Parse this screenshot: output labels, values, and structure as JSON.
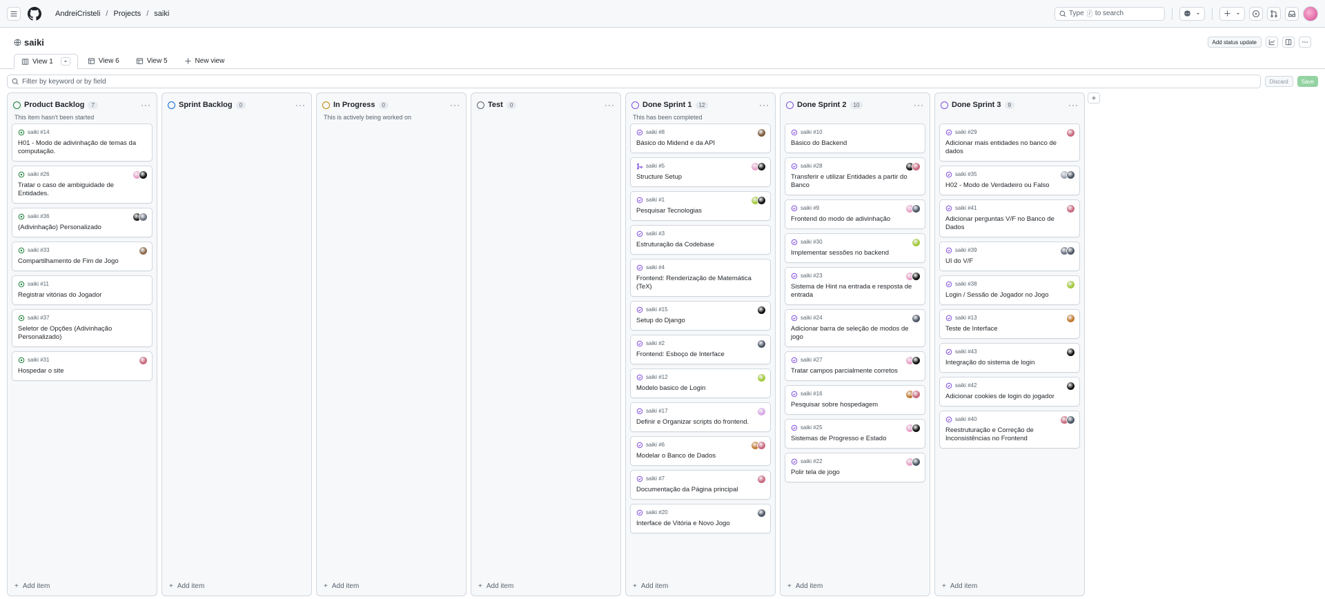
{
  "breadcrumb": {
    "user": "AndreiCristeli",
    "projects": "Projects",
    "project": "saiki"
  },
  "search": {
    "type": "Type",
    "slash": "/",
    "rest": "to search"
  },
  "project": {
    "title": "saiki",
    "status_update": "Add status update"
  },
  "tabs": [
    {
      "label": "View 1",
      "active": true
    },
    {
      "label": "View 6"
    },
    {
      "label": "View 5"
    },
    {
      "label": "New view"
    }
  ],
  "filter": {
    "placeholder": "Filter by keyword or by field",
    "discard": "Discard",
    "save": "Save"
  },
  "add_item_label": "Add item",
  "colors": {
    "green": "#1a7f37",
    "blue": "#0969da",
    "yellow": "#bf8700",
    "gray": "#59636e",
    "purple": "#8250df",
    "done": "#8250df"
  },
  "columns": [
    {
      "name": "Product Backlog",
      "count": "7",
      "status_color": "#1a7f37",
      "description": "This item hasn't been started",
      "cards": [
        {
          "ref": "saiki #14",
          "title": "H01 - Modo de adivinhação de temas da computação.",
          "state": "open",
          "avatars": []
        },
        {
          "ref": "saiki #26",
          "title": "Tratar o caso de ambiguidade de Entidades.",
          "state": "open",
          "avatars": [
            "#e8a1c8",
            "#111111"
          ]
        },
        {
          "ref": "saiki #36",
          "title": "(Adivinhação) Personalizado",
          "state": "open",
          "avatars": [
            "#222222",
            "#6b7280"
          ]
        },
        {
          "ref": "saiki #33",
          "title": "Compartilhamento de Fim de Jogo",
          "state": "open",
          "avatars": [
            "#8b6a4b"
          ]
        },
        {
          "ref": "saiki #11",
          "title": "Registrar vitórias do Jogador",
          "state": "open",
          "avatars": []
        },
        {
          "ref": "saiki #37",
          "title": "Seletor de Opções (Adivinhação Personalizado)",
          "state": "open",
          "avatars": []
        },
        {
          "ref": "saiki #31",
          "title": "Hospedar o site",
          "state": "open",
          "avatars": [
            "#c9687d"
          ]
        }
      ]
    },
    {
      "name": "Sprint Backlog",
      "count": "0",
      "status_color": "#0969da",
      "description": "",
      "cards": []
    },
    {
      "name": "In Progress",
      "count": "0",
      "status_color": "#bf8700",
      "description": "This is actively being worked on",
      "cards": []
    },
    {
      "name": "Test",
      "count": "0",
      "status_color": "#59636e",
      "description": "",
      "cards": []
    },
    {
      "name": "Done Sprint 1",
      "count": "12",
      "status_color": "#8250df",
      "description": "This has been completed",
      "cards": [
        {
          "ref": "saiki #8",
          "title": "Básico do Midend e da API",
          "state": "done",
          "avatars": [
            "#7a5a3a"
          ]
        },
        {
          "ref": "saiki #5",
          "title": "Structure Setup",
          "state": "pr",
          "avatars": [
            "#e8a1c8",
            "#111111"
          ]
        },
        {
          "ref": "saiki #1",
          "title": "Pesquisar Tecnologias",
          "state": "done",
          "avatars": [
            "#a3c93a",
            "#111111"
          ]
        },
        {
          "ref": "saiki #3",
          "title": "Estruturação da Codebase",
          "state": "done",
          "avatars": []
        },
        {
          "ref": "saiki #4",
          "title": "Frontend: Renderização de Matemática (TeX)",
          "state": "done",
          "avatars": []
        },
        {
          "ref": "saiki #15",
          "title": "Setup do Django",
          "state": "done",
          "avatars": [
            "#111111"
          ]
        },
        {
          "ref": "saiki #2",
          "title": "Frontend: Esboço de Interface",
          "state": "done",
          "avatars": [
            "#4b5563"
          ]
        },
        {
          "ref": "saiki #12",
          "title": "Modelo basico de Login",
          "state": "done",
          "avatars": [
            "#a3c93a"
          ]
        },
        {
          "ref": "saiki #17",
          "title": "Definir e Organizar scripts do frontend.",
          "state": "done",
          "avatars": [
            "#d8a8e6"
          ]
        },
        {
          "ref": "saiki #6",
          "title": "Modelar o Banco de Dados",
          "state": "done",
          "avatars": [
            "#c2782d",
            "#c9687d"
          ]
        },
        {
          "ref": "saiki #7",
          "title": "Documentação da Página principal",
          "state": "done",
          "avatars": [
            "#c9687d"
          ]
        },
        {
          "ref": "saiki #20",
          "title": "Interface de Vitória e Novo Jogo",
          "state": "done",
          "avatars": [
            "#4b5563"
          ]
        }
      ]
    },
    {
      "name": "Done Sprint 2",
      "count": "10",
      "status_color": "#8250df",
      "description": "",
      "cards": [
        {
          "ref": "saiki #10",
          "title": "Básico do Backend",
          "state": "done",
          "avatars": []
        },
        {
          "ref": "saiki #28",
          "title": "Transferir e utilizar Entidades a partir do Banco",
          "state": "done",
          "avatars": [
            "#111111",
            "#c9687d"
          ]
        },
        {
          "ref": "saiki #9",
          "title": "Frontend do modo de adivinhação",
          "state": "done",
          "avatars": [
            "#e8a1c8",
            "#4b5563"
          ]
        },
        {
          "ref": "saiki #30",
          "title": "Implementar sessões no backend",
          "state": "done",
          "avatars": [
            "#a3c93a"
          ]
        },
        {
          "ref": "saiki #23",
          "title": "Sistema de Hint na entrada e resposta de entrada",
          "state": "done",
          "avatars": [
            "#e8a1c8",
            "#111111"
          ]
        },
        {
          "ref": "saiki #24",
          "title": "Adicionar barra de seleção de modos de jogo",
          "state": "done",
          "avatars": [
            "#4b5563"
          ]
        },
        {
          "ref": "saiki #27",
          "title": "Tratar campos parcialmente corretos",
          "state": "done",
          "avatars": [
            "#e8a1c8",
            "#111111"
          ]
        },
        {
          "ref": "saiki #16",
          "title": "Pesquisar sobre hospedagem",
          "state": "done",
          "avatars": [
            "#c2782d",
            "#c9687d"
          ]
        },
        {
          "ref": "saiki #25",
          "title": "Sistemas de Progresso e Estado",
          "state": "done",
          "avatars": [
            "#e8a1c8",
            "#111111"
          ]
        },
        {
          "ref": "saiki #22",
          "title": "Polir tela de jogo",
          "state": "done",
          "avatars": [
            "#e8a1c8",
            "#4b5563"
          ]
        }
      ]
    },
    {
      "name": "Done Sprint 3",
      "count": "9",
      "status_color": "#8250df",
      "description": "",
      "cards": [
        {
          "ref": "saiki #29",
          "title": "Adicionar mais entidades no banco de dados",
          "state": "done",
          "avatars": [
            "#c9687d"
          ]
        },
        {
          "ref": "saiki #35",
          "title": "H02 - Modo de Verdadeiro ou Falso",
          "state": "done",
          "avatars": [
            "#9ca3af",
            "#4b5563"
          ]
        },
        {
          "ref": "saiki #41",
          "title": "Adicionar perguntas V/F no Banco de Dados",
          "state": "done",
          "avatars": [
            "#c9687d"
          ]
        },
        {
          "ref": "saiki #39",
          "title": "UI do V/F",
          "state": "done",
          "avatars": [
            "#6b7280",
            "#4b5563"
          ]
        },
        {
          "ref": "saiki #38",
          "title": "Login / Sessão de Jogador no Jogo",
          "state": "done",
          "avatars": [
            "#a3c93a"
          ]
        },
        {
          "ref": "saiki #13",
          "title": "Teste de Interface",
          "state": "done",
          "avatars": [
            "#c2782d"
          ]
        },
        {
          "ref": "saiki #43",
          "title": "Integração do sistema de login",
          "state": "done",
          "avatars": [
            "#111111"
          ]
        },
        {
          "ref": "saiki #42",
          "title": "Adicionar cookies de login do jogador",
          "state": "done",
          "avatars": [
            "#111111"
          ]
        },
        {
          "ref": "saiki #40",
          "title": "Reestruturação e Correção de Inconsistências no Frontend",
          "state": "done",
          "avatars": [
            "#c9687d",
            "#4b5563"
          ]
        }
      ]
    }
  ]
}
